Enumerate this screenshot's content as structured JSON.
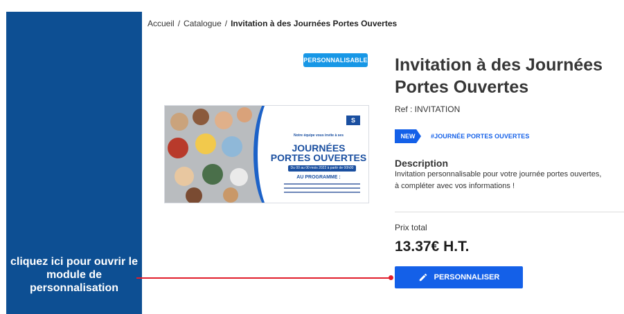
{
  "breadcrumb": {
    "items": [
      "Accueil",
      "Catalogue"
    ],
    "separator": "/",
    "current": "Invitation à des Journées Portes Ouvertes"
  },
  "badge": {
    "label": "PERSONNALISABLE",
    "color": "#1797e6"
  },
  "product": {
    "title": "Invitation à des Journées Portes Ouvertes",
    "ref": "Ref : INVITATION",
    "new_tag": "NEW",
    "hashtag": "#JOURNÉE PORTES OUVERTES",
    "description_title": "Description",
    "description": "Invitation personnalisable pour votre journée portes ouvertes, à compléter avec vos informations !",
    "price_label": "Prix total",
    "price": "13.37€ H.T.",
    "customize_button": "PERSONNALISER",
    "customize_icon": "pencil-icon"
  },
  "thumbnail": {
    "logo": "S",
    "intro": "Notre équipe vous invite à ses",
    "heading_line1": "JOURNÉES",
    "heading_line2": "PORTES OUVERTES",
    "date_line": "Du 00 au 00 mois 2022 à partir de 00h00",
    "program_label": "AU PROGRAMME :"
  },
  "sidebar": {
    "note": "cliquez ici pour ouvrir le module de personnalisation"
  },
  "colors": {
    "accent": "#1460e8",
    "sidebar": "#0d4f93",
    "callout": "#e11d2b"
  }
}
